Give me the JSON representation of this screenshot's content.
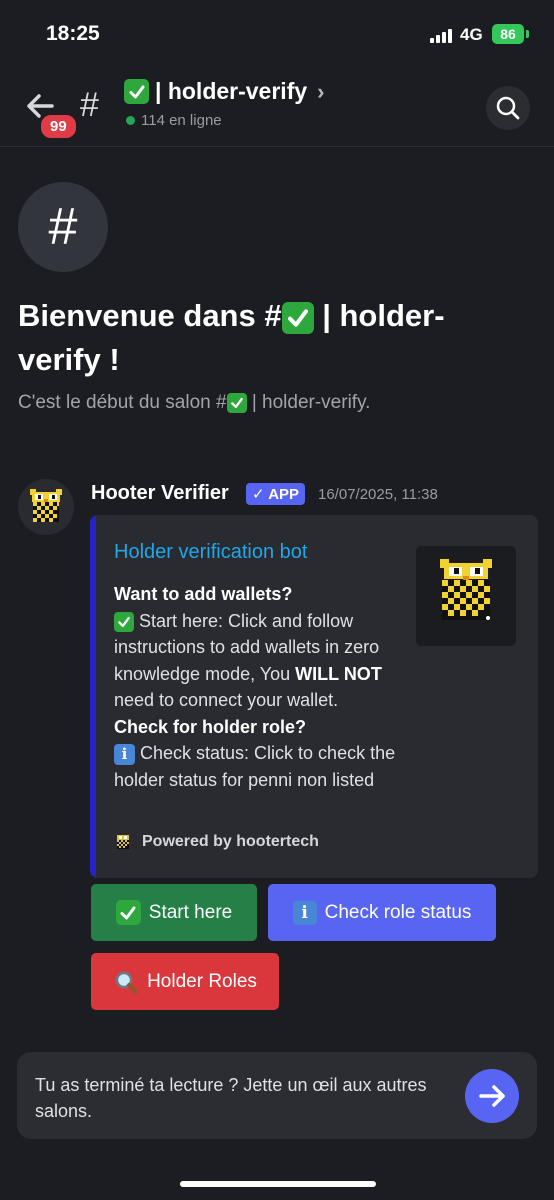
{
  "status_bar": {
    "time": "18:25",
    "network": "4G",
    "battery": "86"
  },
  "header": {
    "unread_badge": "99",
    "channel_name": "| holder-verify",
    "chevron": "›",
    "online": "114 en ligne",
    "icons": [
      "back-arrow-icon",
      "hash-icon",
      "check-emoji-icon",
      "chevron-right-icon",
      "search-icon"
    ]
  },
  "welcome": {
    "title_prefix": "Bienvenue dans #",
    "title_suffix": " | holder-verify !",
    "sub_prefix": "C'est le début du salon #",
    "sub_suffix": " | holder-verify."
  },
  "message": {
    "author": "Hooter Verifier",
    "tag": "APP",
    "timestamp": "16/07/2025, 11:38",
    "embed": {
      "title": "Holder verification bot",
      "h1": "Want to add wallets?",
      "p1_start": " Start here: Click and follow instructions to add wallets in zero knowledge mode, You ",
      "p1_bold": "WILL NOT",
      "p1_end": " need to connect your wallet.",
      "h2": "Check for holder role?",
      "p2": " Check status: Click to check the holder status for penni non listed",
      "footer": "Powered by hootertech"
    }
  },
  "buttons": {
    "start": "Start here",
    "check": "Check role status",
    "roles": "Holder Roles"
  },
  "input": {
    "text": "Tu as terminé ta lecture ? Jette un œil aux autres salons."
  },
  "colors": {
    "accent": "#5865f2",
    "green": "#248046",
    "red": "#da373c",
    "link": "#1fa7e8",
    "online": "#23a55a"
  }
}
